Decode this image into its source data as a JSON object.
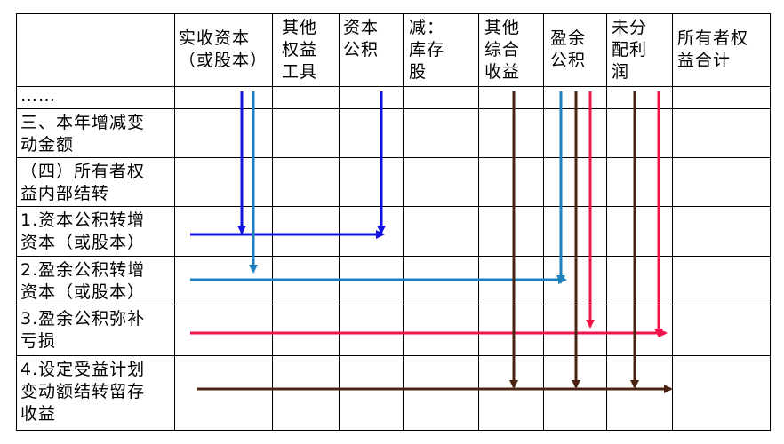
{
  "table": {
    "headers": {
      "paid_in_capital": "实收资本\n（或股本）",
      "other_equity_instruments": "其他\n权益\n工具",
      "capital_reserve": "资本\n公积",
      "less_treasury_stock": "减：\n库存\n股",
      "other_comprehensive_income": "其他\n综合\n收益",
      "surplus_reserve": "盈余\n公积",
      "undistributed_profit": "未分\n配利\n润",
      "total_equity": "所有者权\n益合计"
    },
    "rows": {
      "ellipsis": "……",
      "section_three": "三、本年增减变\n动金额",
      "section_four": "（四）所有者权\n益内部结转",
      "item1": "1.资本公积转增\n资本（或股本）",
      "item2": "2.盈余公积转增\n资本（或股本）",
      "item3": "3.盈余公积弥补\n亏损",
      "item4": "4.设定受益计划\n变动额结转留存\n收益"
    }
  },
  "colors": {
    "blue": "#1010e0",
    "teal": "#1f80c0",
    "red": "#f0144a",
    "brown": "#4a2412"
  }
}
